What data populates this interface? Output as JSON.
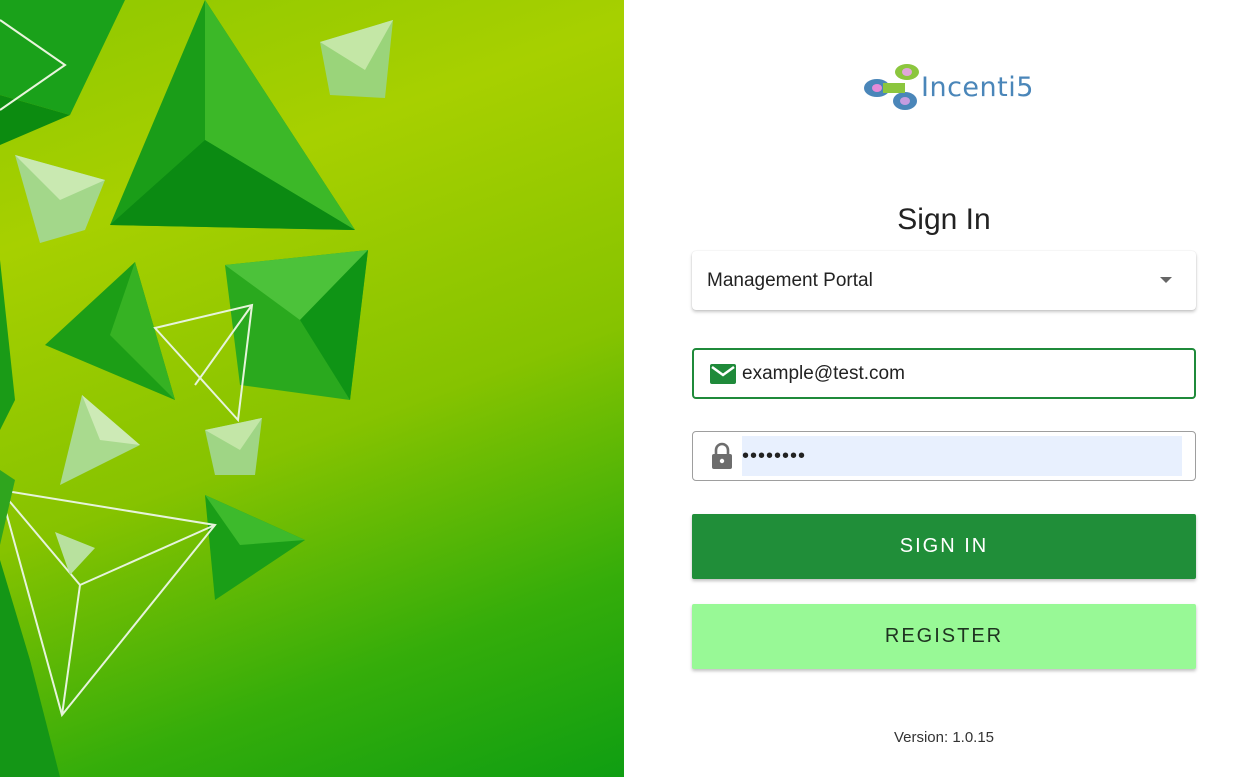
{
  "brand": {
    "name": "Incenti5"
  },
  "signin": {
    "title": "Sign In",
    "portal_selected": "Management Portal",
    "email_value": "example@test.com",
    "password_value": "password",
    "signin_label": "SIGN IN",
    "register_label": "REGISTER"
  },
  "footer": {
    "version": "Version: 1.0.15"
  },
  "colors": {
    "primary": "#208e39",
    "secondary": "#98f996",
    "focus_border": "#1f8a3a",
    "autofill": "#e8f0fe"
  },
  "icons": {
    "email": "email-icon",
    "password": "lock-icon",
    "dropdown": "chevron-down-icon",
    "logo": "incenti5-logo-icon"
  }
}
